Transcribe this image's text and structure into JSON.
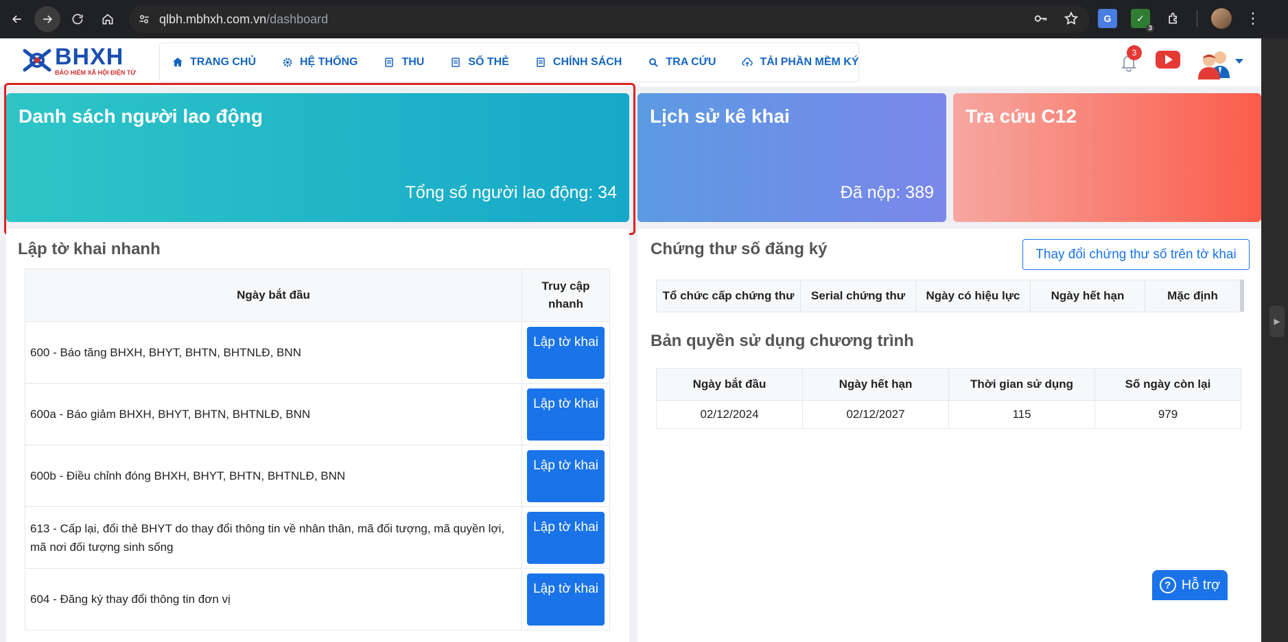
{
  "browser": {
    "url_host": "qlbh.mbhxh.com.vn",
    "url_path": "/dashboard",
    "ext_badge": "3"
  },
  "logo": {
    "name": "BHXH",
    "subtitle": "BẢO HIỂM XÃ HỘI ĐIỆN TỬ"
  },
  "menu": [
    {
      "label": "TRANG CHỦ",
      "icon": "home-icon"
    },
    {
      "label": "HỆ THỐNG",
      "icon": "gear-icon"
    },
    {
      "label": "THU",
      "icon": "document-icon"
    },
    {
      "label": "SỐ THẺ",
      "icon": "document-icon"
    },
    {
      "label": "CHÍNH SÁCH",
      "icon": "document-icon"
    },
    {
      "label": "TRA CỨU",
      "icon": "search-icon"
    },
    {
      "label": "TẢI PHẦN MỀM KÝ",
      "icon": "cloud-upload-icon"
    }
  ],
  "notifications": {
    "count": "3"
  },
  "cards": [
    {
      "title": "Danh sách người lao động",
      "stat": "Tổng số người lao động: 34"
    },
    {
      "title": "Lịch sử kê khai",
      "stat": "Đã nộp: 389"
    },
    {
      "title": "Tra cứu C12",
      "stat": ""
    }
  ],
  "quick_declaration": {
    "title": "Lập tờ khai nhanh",
    "headers": [
      "Ngày bắt đầu",
      "Truy cập nhanh"
    ],
    "button_label": "Lập tờ khai",
    "rows": [
      "600 - Báo tăng BHXH, BHYT, BHTN, BHTNLĐ, BNN",
      "600a - Báo giảm BHXH, BHYT, BHTN, BHTNLĐ, BNN",
      "600b - Điều chỉnh đóng BHXH, BHYT, BHTN, BHTNLĐ, BNN",
      "613 - Cấp lại, đổi thẻ BHYT do thay đổi thông tin về nhân thân, mã đối tượng, mã quyền lợi, mã nơi đối tượng sinh sống",
      "604 - Đăng ký thay đổi thông tin đơn vị"
    ]
  },
  "certificate": {
    "title": "Chứng thư số đăng ký",
    "change_button": "Thay đổi chứng thư số trên tờ khai",
    "headers": [
      "Tổ chức cấp chứng thư",
      "Serial chứng thư",
      "Ngày có hiệu lực",
      "Ngày hết hạn",
      "Mặc định"
    ]
  },
  "license": {
    "title": "Bản quyền sử dụng chương trình",
    "headers": [
      "Ngày bắt đầu",
      "Ngày hết hạn",
      "Thời gian sử dụng",
      "Số ngày còn lại"
    ],
    "row": [
      "02/12/2024",
      "02/12/2027",
      "115",
      "979"
    ]
  },
  "help": {
    "label": "Hỗ trợ"
  },
  "colors": {
    "brand_blue": "#1565c0",
    "button_blue": "#1a73e8",
    "card_teal": "#16a8c8",
    "card_violet": "#7b87ea",
    "card_red": "#fb5c4a",
    "highlight_red": "#e02020"
  }
}
